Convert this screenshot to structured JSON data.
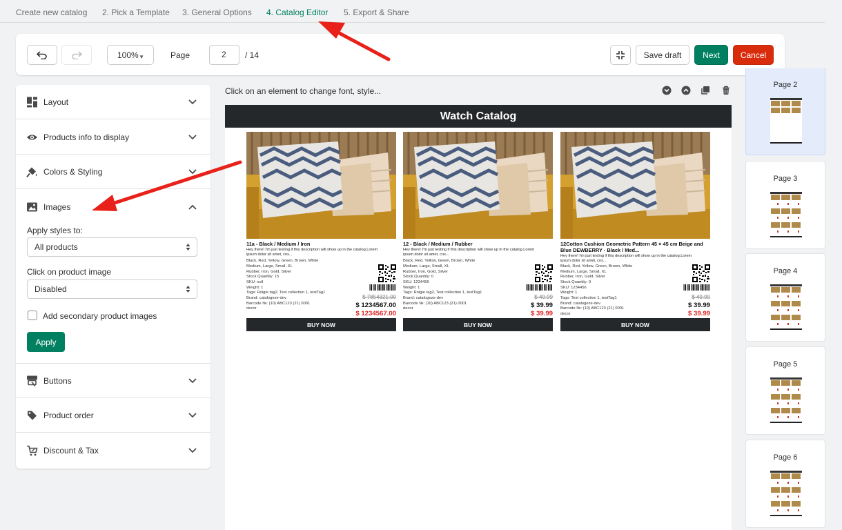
{
  "steps": [
    "Create new catalog",
    "2. Pick a Template",
    "3. General Options",
    "4. Catalog Editor",
    "5. Export & Share"
  ],
  "toolbar": {
    "zoom": "100%",
    "page_label": "Page",
    "page_value": "2",
    "page_total": "/ 14",
    "save_draft": "Save draft",
    "next": "Next",
    "cancel": "Cancel"
  },
  "panel": {
    "sections": {
      "layout": "Layout",
      "products_info": "Products info to display",
      "colors": "Colors & Styling",
      "images": "Images",
      "buttons": "Buttons",
      "product_order": "Product order",
      "discount": "Discount & Tax"
    },
    "images": {
      "apply_styles_label": "Apply styles to:",
      "apply_styles_value": "All products",
      "click_label": "Click on product image",
      "click_value": "Disabled",
      "secondary_label": "Add secondary product images",
      "apply_button": "Apply"
    }
  },
  "canvas": {
    "hint": "Click on an element to change font, style...",
    "catalog_title": "Watch Catalog",
    "products": [
      {
        "title": "11a - Black / Medium / Iron",
        "desc": "Hey there! I'm just testing if this description will show up in the catalog.Lorem ipsum dolor sit amet, cns...",
        "meta": [
          "Black, Red, Yellow, Green, Brown, White",
          "Medium, Large, Small, XL",
          "Rubber, Iron, Gold, Silver",
          "Stock Quantity: 15",
          "SKU: null",
          "Weight: 1",
          "Tags: Rolgie tag2, Test collection 1, testTag1",
          "Brand: catalogeze-dev",
          "Barcode №: (10) ABC123 (21) 0001",
          "decor"
        ],
        "old_price": "$ 7854321.00",
        "price": "$ 1234567.00",
        "sale_price": "$ 1234567.00",
        "button": "BUY NOW"
      },
      {
        "title": "12 - Black / Medium / Rubber",
        "desc": "Hey there! I'm just testing if this description will show up in the catalog.Lorem ipsum dolor sit amet, cns...",
        "meta": [
          "Black, Red, Yellow, Green, Brown, White",
          "Medium, Large, Small, XL",
          "Rubber, Iron, Gold, Silver",
          "Stock Quantity: 0",
          "SKU: 1234456",
          "Weight: 1",
          "Tags: Rolgie tag2, Test collection 1, testTag1",
          "Brand: catalogeze-dev",
          "Barcode №: (10) ABC123 (21) 0001",
          "decor"
        ],
        "old_price": "$ 49.99",
        "price": "$ 39.99",
        "sale_price": "$ 39.99",
        "button": "BUY NOW"
      },
      {
        "title": "12Cotton Cushion Geometric Pattern 45 × 45 cm Beige and Blue DEWBERRY - Black / Med...",
        "desc": "Hey there! I'm just testing if this description will show up in the catalog.Lorem ipsum dolor sit amet, cns...",
        "meta": [
          "Black, Red, Yellow, Green, Brown, White",
          "Medium, Large, Small, XL",
          "Rubber, Iron, Gold, Silver",
          "Stock Quantity: 0",
          "SKU: 1234456",
          "Weight: 1",
          "Tags: Test collection 1, testTag1",
          "Brand: catalogeze-dev",
          "Barcode №: (10) ABC123 (21) 0001",
          "decor"
        ],
        "old_price": "$ 49.99",
        "price": "$ 39.99",
        "sale_price": "$ 39.99",
        "button": "BUY NOW"
      }
    ]
  },
  "thumbnails": [
    "Page 2",
    "Page 3",
    "Page 4",
    "Page 5",
    "Page 6"
  ],
  "colors": {
    "primary": "#008060",
    "danger": "#d82c0d",
    "header_dark": "#25282b",
    "sale": "#e02020",
    "annotation": "#e8211a"
  }
}
